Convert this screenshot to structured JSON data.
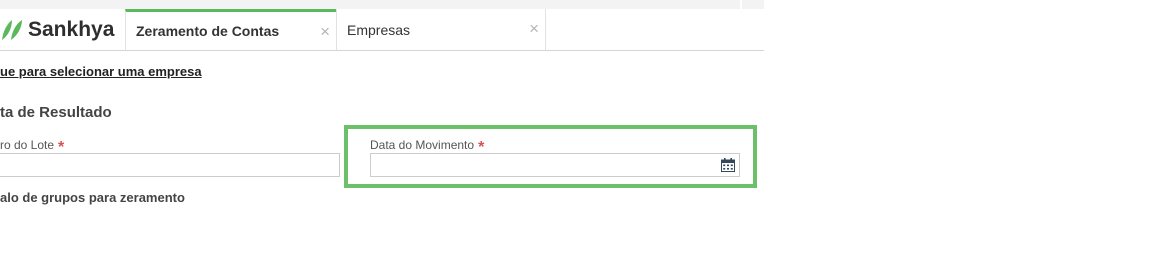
{
  "brand": {
    "name": "Sankhya",
    "accent_color": "#5cb85c",
    "icon": "sankhya-leaf-logo"
  },
  "tabs": [
    {
      "label": "Zeramento de Contas",
      "active": true,
      "close_icon": "close-icon"
    },
    {
      "label": "Empresas",
      "active": false,
      "close_icon": "close-icon"
    }
  ],
  "tab_close_glyph": "×",
  "select_company_link": "ue para selecionar uma empresa",
  "section_result": "ta de Resultado",
  "fields": {
    "lot_number": {
      "label": "ro do Lote",
      "required_mark": "*",
      "value": ""
    },
    "movement_date": {
      "label": "Data do Movimento",
      "required_mark": "*",
      "value": "",
      "icon": "calendar-icon"
    }
  },
  "section_groups": "alo de grupos para zeramento",
  "colors": {
    "required": "#d9534f",
    "highlight_border": "#6cc06a"
  }
}
